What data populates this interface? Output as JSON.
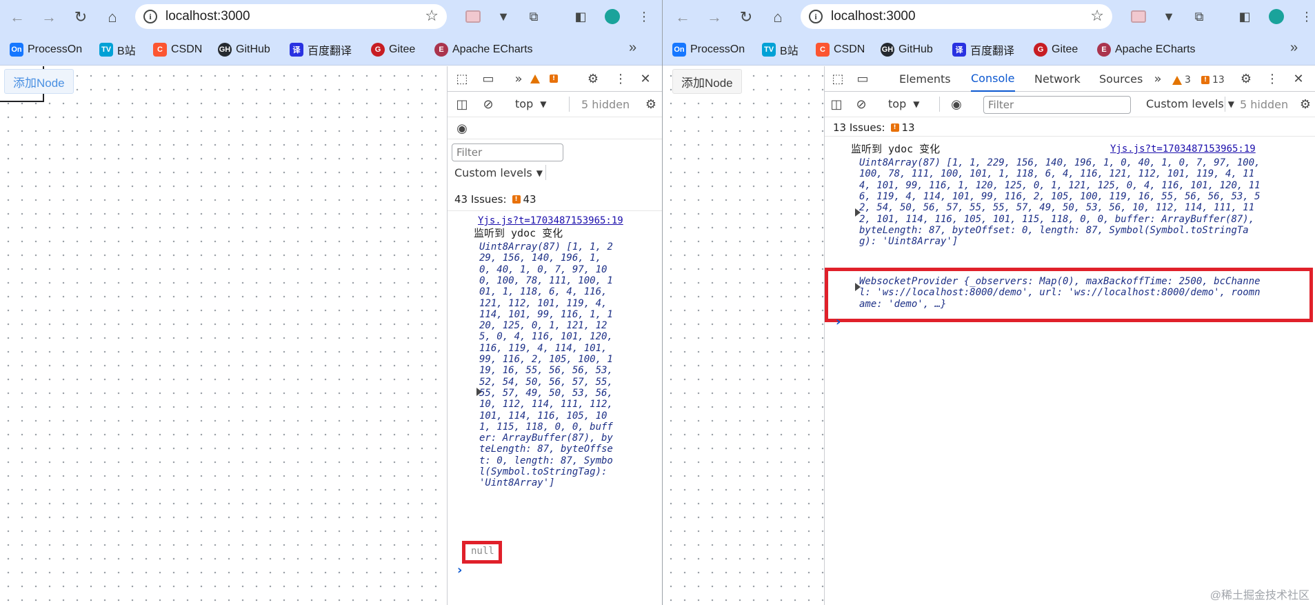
{
  "browser": {
    "url": "localhost:3000",
    "bookmarks": [
      {
        "label": "ProcessOn",
        "icon": "On",
        "color": "#1677ff"
      },
      {
        "label": "B站",
        "icon": "TV",
        "color": "#00a1d6"
      },
      {
        "label": "CSDN",
        "icon": "C",
        "color": "#fc5531"
      },
      {
        "label": "GitHub",
        "icon": "GH",
        "color": "#24292f"
      },
      {
        "label": "百度翻译",
        "icon": "译",
        "color": "#2932e1"
      },
      {
        "label": "Gitee",
        "icon": "G",
        "color": "#c71d23"
      },
      {
        "label": "Apache ECharts",
        "icon": "E",
        "color": "#aa344d"
      }
    ],
    "more": "»"
  },
  "app": {
    "add_node_label": "添加Node"
  },
  "left": {
    "devtools": {
      "warn_count": "",
      "context": "top",
      "hidden": "5 hidden",
      "filter_placeholder": "Filter",
      "levels": "Custom levels",
      "issues_label": "43 Issues:",
      "issues_count": "43"
    },
    "console": {
      "source": "Yjs.js?t=1703487153965:19",
      "message": "监听到 ydoc 变化",
      "lines": [
        "Uint8Array(87) [1, 1, 2",
        "29, 156, 140, 196, 1,",
        "0, 40, 1, 0, 7, 97, 10",
        "0, 100, 78, 111, 100, 1",
        "01, 1, 118, 6, 4, 116,",
        "121, 112, 101, 119, 4,",
        "114, 101, 99, 116, 1, 1",
        "20, 125, 0, 1, 121, 12",
        "5, 0, 4, 116, 101, 120,",
        "116, 119, 4, 114, 101,",
        "99, 116, 2, 105, 100, 1",
        "19, 16, 55, 56, 56, 53,",
        "52, 54, 50, 56, 57, 55,",
        "55, 57, 49, 50, 53, 56,",
        "10, 112, 114, 111, 112,",
        "101, 114, 116, 105, 10",
        "1, 115, 118, 0, 0, buff",
        "er: ArrayBuffer(87), by",
        "teLength: 87, byteOffse",
        "t: 0, length: 87, Symbo",
        "l(Symbol.toStringTag):",
        "'Uint8Array']"
      ],
      "null_value": "null"
    }
  },
  "right": {
    "devtools": {
      "tabs": [
        "Elements",
        "Console",
        "Network",
        "Sources"
      ],
      "active_tab": "Console",
      "warn_count": "3",
      "err_count": "13",
      "context": "top",
      "filter_placeholder": "Filter",
      "levels": "Custom levels",
      "hidden": "5 hidden",
      "issues_label": "13 Issues:",
      "issues_count": "13"
    },
    "console": {
      "message": "监听到 ydoc 变化",
      "source": "Yjs.js?t=1703487153965:19",
      "lines": [
        "Uint8Array(87) [1, 1, 229, 156, 140, 196, 1, 0, 40, 1, 0, 7, 97, 100,",
        "100, 78, 111, 100, 101, 1, 118, 6, 4, 116, 121, 112, 101, 119, 4, 11",
        "4, 101, 99, 116, 1, 120, 125, 0, 1, 121, 125, 0, 4, 116, 101, 120, 11",
        "6, 119, 4, 114, 101, 99, 116, 2, 105, 100, 119, 16, 55, 56, 56, 53, 5",
        "2, 54, 50, 56, 57, 55, 55, 57, 49, 50, 53, 56, 10, 112, 114, 111, 11",
        "2, 101, 114, 116, 105, 101, 115, 118, 0, 0, buffer: ArrayBuffer(87),",
        "byteLength: 87, byteOffset: 0, length: 87, Symbol(Symbol.toStringTa",
        "g): 'Uint8Array']"
      ],
      "ws_lines": [
        "WebsocketProvider {_observers: Map(0), maxBackoffTime: 2500, bcChanne",
        "l: 'ws://localhost:8000/demo', url: 'ws://localhost:8000/demo', roomn",
        "ame: 'demo', …}"
      ]
    }
  },
  "watermark": "@稀土掘金技术社区",
  "colors": {
    "chrome": "#d3e3fd",
    "accent": "#0b57d0",
    "highlight_box": "#e0202a",
    "add_button_left": "#4a90e2",
    "add_button_right": "#3c3c3c"
  }
}
